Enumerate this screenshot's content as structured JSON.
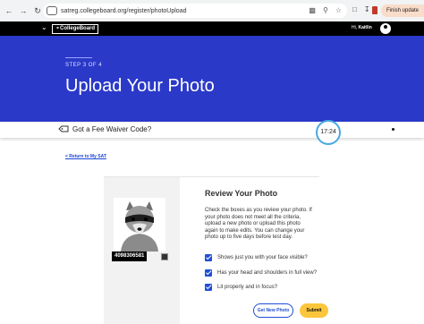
{
  "browser": {
    "url": "satreg.collegeboard.org/register/photoUpload",
    "finish_update_label": "Finish update"
  },
  "header": {
    "logo_text": "CollegeBoard",
    "greeting_prefix": "Hi, ",
    "user_name": "Kaitlin"
  },
  "banner": {
    "step": "STEP 3 OF 4",
    "title": "Upload Your Photo"
  },
  "fee_waiver": {
    "label": "Got a Fee Waiver Code?"
  },
  "timer": {
    "value": "17:24"
  },
  "return_link": "< Return to My SAT",
  "review": {
    "title": "Review Your Photo",
    "body": "Check the boxes as you review your photo. If your photo does not meet all the criteria, upload a new photo or upload this photo again to make edits. You can change your photo up to five days before test day.",
    "photo_id": "4098306581",
    "checks": [
      {
        "label": "Shows just you with your face visible?",
        "checked": true
      },
      {
        "label": "Has your head and shoulders in full view?",
        "checked": true
      },
      {
        "label": "Lit properly and in focus?",
        "checked": true
      }
    ],
    "get_new_photo_label": "Get New Photo",
    "submit_label": "Submit"
  },
  "colors": {
    "banner": "#2a39c8",
    "accent": "#1f4fd6",
    "submit": "#fcc63c",
    "timer_ring": "#4aa8e0"
  }
}
